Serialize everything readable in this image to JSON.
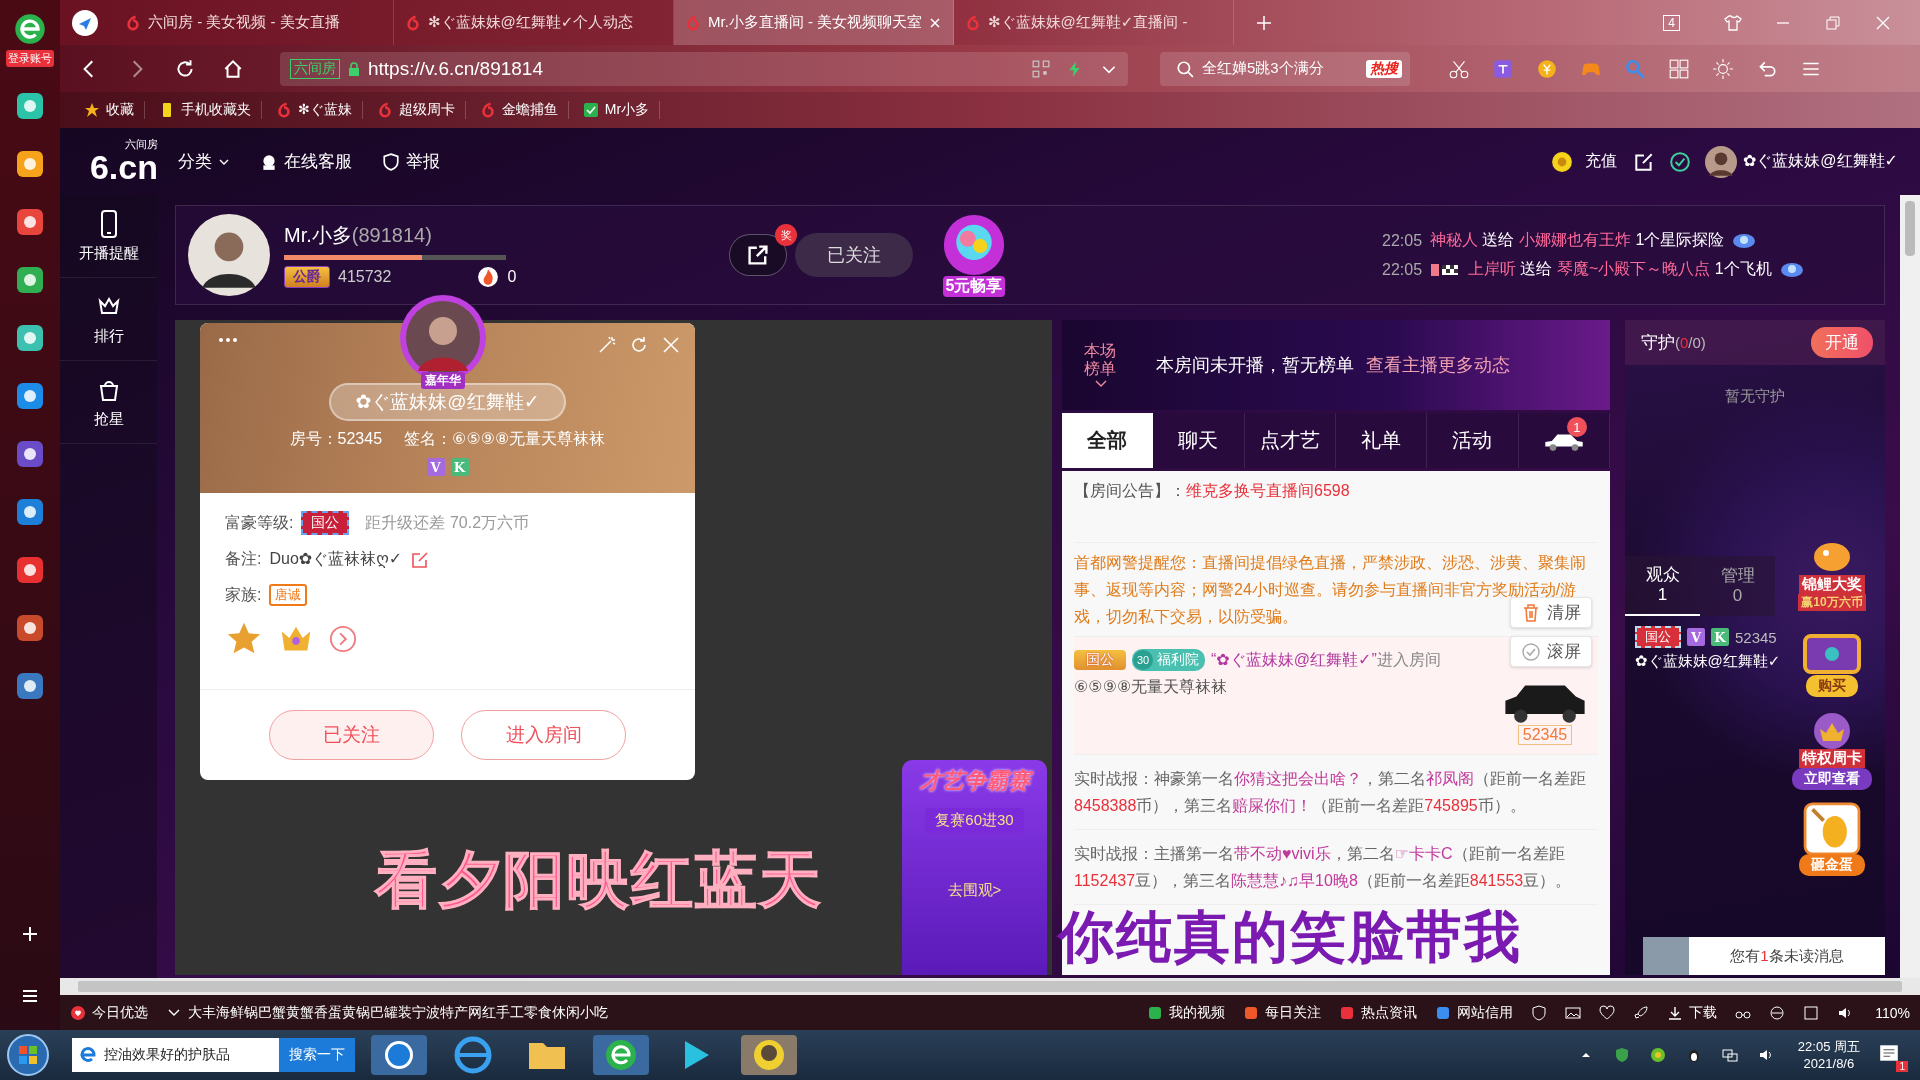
{
  "browser_sidebar": {
    "login_label": "登录账号"
  },
  "browser_tabs": [
    {
      "title": "六间房 - 美女视频 - 美女直播",
      "selected": false
    },
    {
      "title": "✻ぐ蓝妹妹@红舞鞋✓个人动态",
      "selected": false
    },
    {
      "title": "Mr.小多直播间 - 美女视频聊天室",
      "selected": true
    },
    {
      "title": "✻ぐ蓝妹妹@红舞鞋✓直播间 -",
      "selected": false
    }
  ],
  "tab_count": "4",
  "address_bar": {
    "site_label": "六间房",
    "url": "https://v.6.cn/891814"
  },
  "search": {
    "value": "全红婵5跳3个满分",
    "hot_label": "热搜"
  },
  "bookmarks": [
    "收藏",
    "手机收藏夹",
    "✻ぐ蓝妹",
    "超级周卡",
    "金蟾捕鱼",
    "Mr小多"
  ],
  "site_header": {
    "logo_small": "六间房",
    "logo": "6.cn",
    "nav": [
      "分类",
      "在线客服",
      "举报"
    ],
    "recharge": "充值",
    "user": "✿ぐ蓝妹妹@红舞鞋✓"
  },
  "site_nav": [
    "开播提醒",
    "排行",
    "抢星"
  ],
  "streamer": {
    "name": "Mr.小多",
    "room_id": "(891814)",
    "level": 0.62,
    "rank_badge": "公爵",
    "score": "415732",
    "heat": "0",
    "share_badge": "奖",
    "follow": "已关注",
    "promo": "5元畅享"
  },
  "gift_feed": [
    {
      "time": "22:05",
      "sender": "神秘人",
      "verb": "送给",
      "receiver": "小娜娜也有王炸",
      "gift": "1个星际探险"
    },
    {
      "time": "22:05",
      "sender": "上岸听",
      "verb": "送给",
      "receiver": "琴魔~小殿下～晚八点",
      "gift": "1个飞机"
    }
  ],
  "profile_card": {
    "frame_label": "嘉年华",
    "name": "✿ぐ蓝妹妹@红舞鞋✓",
    "room": "房号：52345",
    "signature": "签名：⑥⑤⑨⑧无量天尊袜袜",
    "badges": [
      "V",
      "K"
    ],
    "wealth_label": "富豪等级:",
    "wealth_badge": "国公",
    "wealth_note": "距升级还差 70.2万六币",
    "remark_label": "备注:",
    "remark": "Duo✿ぐ蓝袜袜ღ✓",
    "family_label": "家族:",
    "family": "唐诚",
    "buttons": [
      "已关注",
      "进入房间"
    ]
  },
  "contest": {
    "title": "才艺争霸赛",
    "stage": "复赛60进30",
    "link": "去围观>"
  },
  "ranking": {
    "label": "本场榜单",
    "message": "本房间未开播，暂无榜单",
    "link": "查看主播更多动态"
  },
  "chat_tabs": [
    {
      "kind": "text",
      "label": "全部",
      "selected": true
    },
    {
      "kind": "text",
      "label": "聊天",
      "selected": false
    },
    {
      "kind": "text",
      "label": "点才艺",
      "selected": false
    },
    {
      "kind": "text",
      "label": "礼单",
      "selected": false
    },
    {
      "kind": "text",
      "label": "活动",
      "selected": false
    },
    {
      "kind": "car",
      "badge": "1",
      "selected": false
    }
  ],
  "announcement": {
    "label": "【房间公告】：",
    "text": "维克多换号直播间6598"
  },
  "warning": "首都网警提醒您：直播间提倡绿色直播，严禁涉政、涉恐、涉黄、聚集闹事、返现等内容；网警24小时巡查。请勿参与直播间非官方奖励活动/游戏，切勿私下交易，以防受骗。",
  "entry": {
    "badge": "国公",
    "level": "30",
    "group": "福利院",
    "name": "“✿ぐ蓝妹妹@红舞鞋✓”",
    "action": "进入房间",
    "signature": "⑥⑤⑨⑧无量天尊袜袜",
    "car_number": "52345"
  },
  "chat_controls": [
    "清屏",
    "滚屏"
  ],
  "reports": [
    [
      {
        "kind": "plain",
        "text": "实时战报：神豪第一名"
      },
      {
        "kind": "name",
        "text": "你猜这把会出啥？"
      },
      {
        "kind": "plain",
        "text": "，第二名"
      },
      {
        "kind": "name",
        "text": "祁凤阁"
      },
      {
        "kind": "plain",
        "text": "（距前一名差距"
      },
      {
        "kind": "number",
        "text": "8458388"
      },
      {
        "kind": "plain",
        "text": "币），第三名"
      },
      {
        "kind": "name",
        "text": "赔屎你们！"
      },
      {
        "kind": "plain",
        "text": "（距前一名差距"
      },
      {
        "kind": "number",
        "text": "745895"
      },
      {
        "kind": "plain",
        "text": "币）。"
      }
    ],
    [
      {
        "kind": "plain",
        "text": "实时战报：主播第一名"
      },
      {
        "kind": "name",
        "text": "带不动♥vivi乐"
      },
      {
        "kind": "plain",
        "text": "，第二名"
      },
      {
        "kind": "name",
        "text": "☞卡卡C"
      },
      {
        "kind": "plain",
        "text": "（距前一名差距"
      },
      {
        "kind": "number",
        "text": "1152437"
      },
      {
        "kind": "plain",
        "text": "豆），第三名"
      },
      {
        "kind": "name",
        "text": "陈慧慧♪♫早10晚8"
      },
      {
        "kind": "plain",
        "text": "（距前一名差距"
      },
      {
        "kind": "number",
        "text": "841553"
      },
      {
        "kind": "plain",
        "text": "豆）。"
      }
    ]
  ],
  "guard": {
    "title": "守护",
    "count_open": "(",
    "count": "0",
    "total": "/0)",
    "open": "开通",
    "empty": "暂无守护"
  },
  "audience_tabs": [
    {
      "label": "观众",
      "count": "1",
      "selected": true
    },
    {
      "label": "管理",
      "count": "0",
      "selected": false
    }
  ],
  "viewer": {
    "badge": "国公",
    "badges": [
      "V",
      "K"
    ],
    "id": "52345",
    "name": "✿ぐ蓝妹妹@红舞鞋✓"
  },
  "promos": [
    {
      "kind": "koi",
      "title": "锦鲤大奖",
      "sub": "赢10万六币"
    },
    {
      "kind": "chest",
      "button": "购买"
    },
    {
      "kind": "card",
      "title": "特权周卡",
      "button": "立即查看"
    },
    {
      "kind": "egg",
      "button": "砸金蛋"
    }
  ],
  "unread": {
    "prefix": "您有",
    "count": "1",
    "suffix": "条未读消息"
  },
  "lyrics": [
    "看夕阳映红蓝天",
    "你纯真的笑脸带我"
  ],
  "status_bar": {
    "pick": "今日优选",
    "news": "大丰海鲜锅巴蟹黄蟹香蛋黄锅巴罐装宁波特产网红手工零食休闲小吃",
    "items": [
      "我的视频",
      "每日关注",
      "热点资讯",
      "网站信用"
    ],
    "download": "下载",
    "zoom": "110%"
  },
  "taskbar": {
    "search": "控油效果好的护肤品",
    "search_button": "搜索一下",
    "time": "22:05 周五",
    "date": "2021/8/6",
    "notifications": "1"
  }
}
